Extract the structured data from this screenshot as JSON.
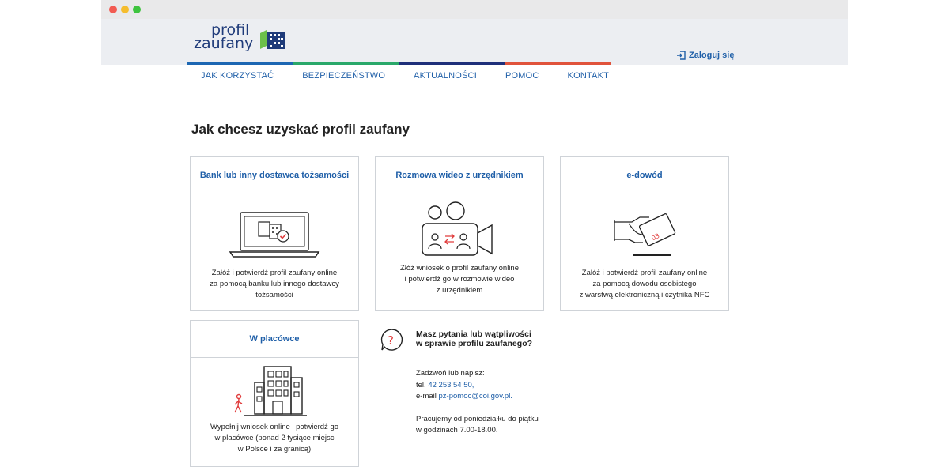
{
  "header": {
    "logo_line1": "profil",
    "logo_line2": "zaufany",
    "login_label": "Zaloguj się"
  },
  "nav": [
    "JAK KORZYSTAĆ",
    "BEZPIECZEŃSTWO",
    "AKTUALNOŚCI",
    "POMOC",
    "KONTAKT"
  ],
  "page_title": "Jak chcesz uzyskać profil zaufany",
  "cards": [
    {
      "title": "Bank lub inny dostawca tożsamości",
      "description": "Załóż i potwierdź profil zaufany online\nza pomocą banku lub innego dostawcy\ntożsamości"
    },
    {
      "title": "Rozmowa wideo z urzędnikiem",
      "description": "Złóż wniosek o profil zaufany online\ni potwierdź go w rozmowie wideo\nz urzędnikiem"
    },
    {
      "title": "e-dowód",
      "description": "Załóż i potwierdź profil zaufany online\nza pomocą dowodu osobistego\nz warstwą elektroniczną i czytnika NFC"
    },
    {
      "title": "W placówce",
      "description": "Wypełnij wniosek online i potwierdź go\nw placówce (ponad 2 tysiące miejsc\nw Polsce i za granicą)"
    }
  ],
  "help": {
    "title": "Masz pytania lub wątpliwości\nw sprawie profilu zaufanego?",
    "contact_intro": "Zadzwoń lub napisz:",
    "tel_label": "tel.",
    "tel_value": "42 253 54 50,",
    "email_label": "e-mail",
    "email_value": "pz-pomoc@coi.gov.pl.",
    "hours_line1": "Pracujemy od poniedziałku do piątku",
    "hours_line2": "w godzinach 7.00-18.00."
  },
  "colors": {
    "accent": "#1f5fa8",
    "logo_navy": "#1f3b7a",
    "illustration_red": "#e03c3c"
  }
}
